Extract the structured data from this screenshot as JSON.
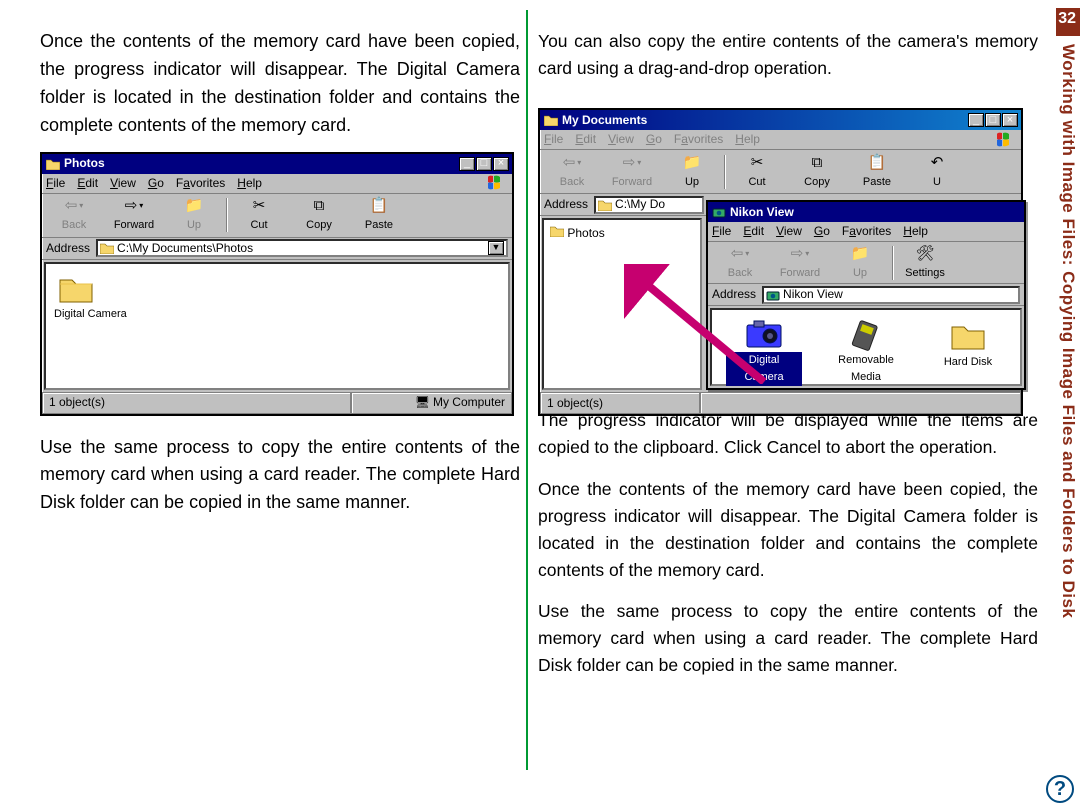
{
  "page_number": "32",
  "side_title": "Working with Image Files: Copying Image Files and Folders to Disk",
  "left": {
    "p1": "Once the contents of the memory card have been copied, the progress indicator will disappear. The Digital Camera folder is located in the destination folder and contains the complete contents of the memory card.",
    "p2": "Use the same process to copy the entire contents of the memory card when using a card reader. The complete Hard Disk folder can be copied in the same manner."
  },
  "right": {
    "p1": "You can also copy the entire contents of the camera's memory card using a drag-and-drop operation.",
    "p2": "The progress indicator will be displayed while the items are copied to the clipboard. Click Cancel to abort the operation.",
    "p3": "Once the contents of the memory card have been copied, the progress indicator will disappear. The Digital Camera folder is located in the destination folder and contains the complete contents of the memory card.",
    "p4": "Use the same process to copy the entire contents of the memory card when using a card reader. The complete Hard Disk folder can be copied in the same manner."
  },
  "win_photos": {
    "title": "Photos",
    "menu": {
      "file": "File",
      "edit": "Edit",
      "view": "View",
      "go": "Go",
      "favorites": "Favorites",
      "help": "Help"
    },
    "toolbar": {
      "back": "Back",
      "forward": "Forward",
      "up": "Up",
      "cut": "Cut",
      "copy": "Copy",
      "paste": "Paste"
    },
    "address_label": "Address",
    "address_value": "C:\\My Documents\\Photos",
    "item_label": "Digital Camera",
    "status_left": "1 object(s)",
    "status_right": "My Computer"
  },
  "win_mydocs": {
    "title": "My Documents",
    "menu": {
      "file": "File",
      "edit": "Edit",
      "view": "View",
      "go": "Go",
      "favorites": "Favorites",
      "help": "Help"
    },
    "toolbar": {
      "back": "Back",
      "forward": "Forward",
      "up": "Up",
      "cut": "Cut",
      "copy": "Copy",
      "paste": "Paste",
      "u": "U"
    },
    "address_label": "Address",
    "address_value": "C:\\My Do",
    "tree_item": "Photos",
    "status": "1 object(s)"
  },
  "win_nikon": {
    "title": "Nikon View",
    "menu": {
      "file": "File",
      "edit": "Edit",
      "view": "View",
      "go": "Go",
      "favorites": "Favorites",
      "help": "Help"
    },
    "toolbar": {
      "back": "Back",
      "forward": "Forward",
      "up": "Up",
      "settings": "Settings"
    },
    "address_label": "Address",
    "address_value": "Nikon View",
    "items": {
      "digital_camera": "Digital Camera",
      "removable_media": "Removable\nMedia",
      "hard_disk": "Hard Disk"
    }
  },
  "help_glyph": "?"
}
